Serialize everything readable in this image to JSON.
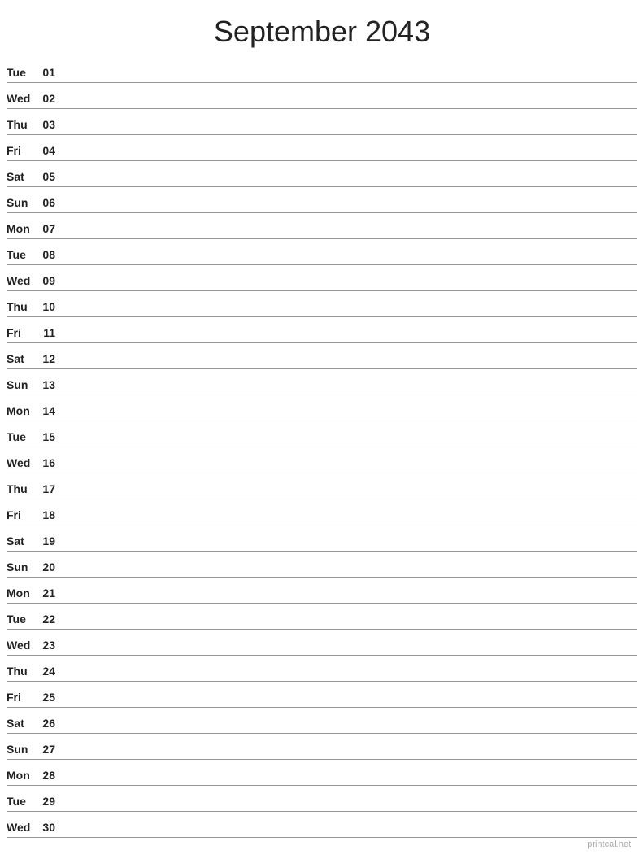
{
  "header": {
    "title": "September 2043"
  },
  "days": [
    {
      "name": "Tue",
      "number": "01"
    },
    {
      "name": "Wed",
      "number": "02"
    },
    {
      "name": "Thu",
      "number": "03"
    },
    {
      "name": "Fri",
      "number": "04"
    },
    {
      "name": "Sat",
      "number": "05"
    },
    {
      "name": "Sun",
      "number": "06"
    },
    {
      "name": "Mon",
      "number": "07"
    },
    {
      "name": "Tue",
      "number": "08"
    },
    {
      "name": "Wed",
      "number": "09"
    },
    {
      "name": "Thu",
      "number": "10"
    },
    {
      "name": "Fri",
      "number": "11"
    },
    {
      "name": "Sat",
      "number": "12"
    },
    {
      "name": "Sun",
      "number": "13"
    },
    {
      "name": "Mon",
      "number": "14"
    },
    {
      "name": "Tue",
      "number": "15"
    },
    {
      "name": "Wed",
      "number": "16"
    },
    {
      "name": "Thu",
      "number": "17"
    },
    {
      "name": "Fri",
      "number": "18"
    },
    {
      "name": "Sat",
      "number": "19"
    },
    {
      "name": "Sun",
      "number": "20"
    },
    {
      "name": "Mon",
      "number": "21"
    },
    {
      "name": "Tue",
      "number": "22"
    },
    {
      "name": "Wed",
      "number": "23"
    },
    {
      "name": "Thu",
      "number": "24"
    },
    {
      "name": "Fri",
      "number": "25"
    },
    {
      "name": "Sat",
      "number": "26"
    },
    {
      "name": "Sun",
      "number": "27"
    },
    {
      "name": "Mon",
      "number": "28"
    },
    {
      "name": "Tue",
      "number": "29"
    },
    {
      "name": "Wed",
      "number": "30"
    }
  ],
  "footer": {
    "text": "printcal.net"
  }
}
